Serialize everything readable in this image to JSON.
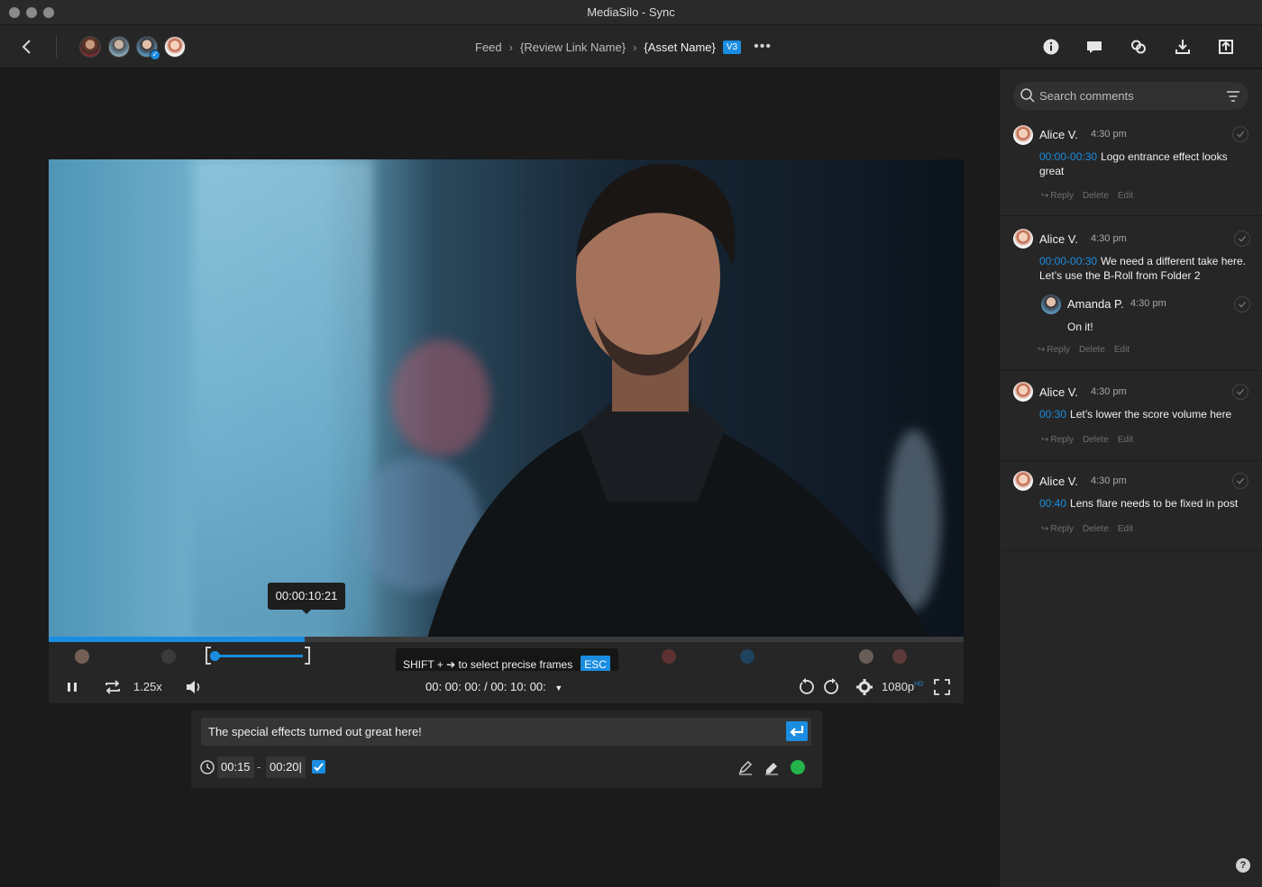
{
  "window": {
    "title": "MediaSilo  -  Sync"
  },
  "toolbar": {
    "breadcrumb": [
      {
        "label": "Feed"
      },
      {
        "label": "{Review Link Name}"
      },
      {
        "label": "{Asset Name}"
      }
    ],
    "version_badge": "V3",
    "more": "•••",
    "icons": [
      "info-icon",
      "comments-icon",
      "link-icon",
      "download-icon",
      "upload-icon"
    ],
    "avatars": [
      "avatar-1",
      "avatar-2",
      "avatar-3",
      "avatar-4"
    ]
  },
  "player": {
    "hover_timecode": "00:00:10:21",
    "progress_fraction": 0.28,
    "speed": "1.25x",
    "current_time": "00: 00: 00:",
    "duration": "00: 10: 00:",
    "time_separator": "/",
    "quality": "1080p",
    "quality_badge": "HD",
    "shift_tip": "SHIFT + ➔ to select precise frames",
    "esc_label": "ESC",
    "colors": {
      "accent": "#1a8de0"
    }
  },
  "composer": {
    "text": "The special effects turned out great here!",
    "start": "00:15",
    "dash": "-",
    "end": "00:20|",
    "color": "#25b34b"
  },
  "sidebar": {
    "search_placeholder": "Search comments",
    "comments": [
      {
        "name": "Alice V.",
        "time": "4:30 pm",
        "ts": "00:00-00:30",
        "text": "Logo entrance effect looks great",
        "actions": [
          "Reply",
          "Delete",
          "Edit"
        ]
      },
      {
        "name": "Alice V.",
        "time": "4:30 pm",
        "ts": "00:00-00:30",
        "text": "We need a different take here. Let’s use the B-Roll from Folder 2",
        "reply": {
          "name": "Amanda P.",
          "time": "4:30 pm",
          "text": "On it!"
        },
        "actions": [
          "Reply",
          "Delete",
          "Edit"
        ]
      },
      {
        "name": "Alice V.",
        "time": "4:30 pm",
        "ts": "00:30",
        "text": "Let’s lower the score volume here",
        "actions": [
          "Reply",
          "Delete",
          "Edit"
        ]
      },
      {
        "name": "Alice V.",
        "time": "4:30 pm",
        "ts": "00:40",
        "text": "Lens flare needs to be fixed in post",
        "actions": [
          "Reply",
          "Delete",
          "Edit"
        ]
      }
    ]
  },
  "help": "?"
}
